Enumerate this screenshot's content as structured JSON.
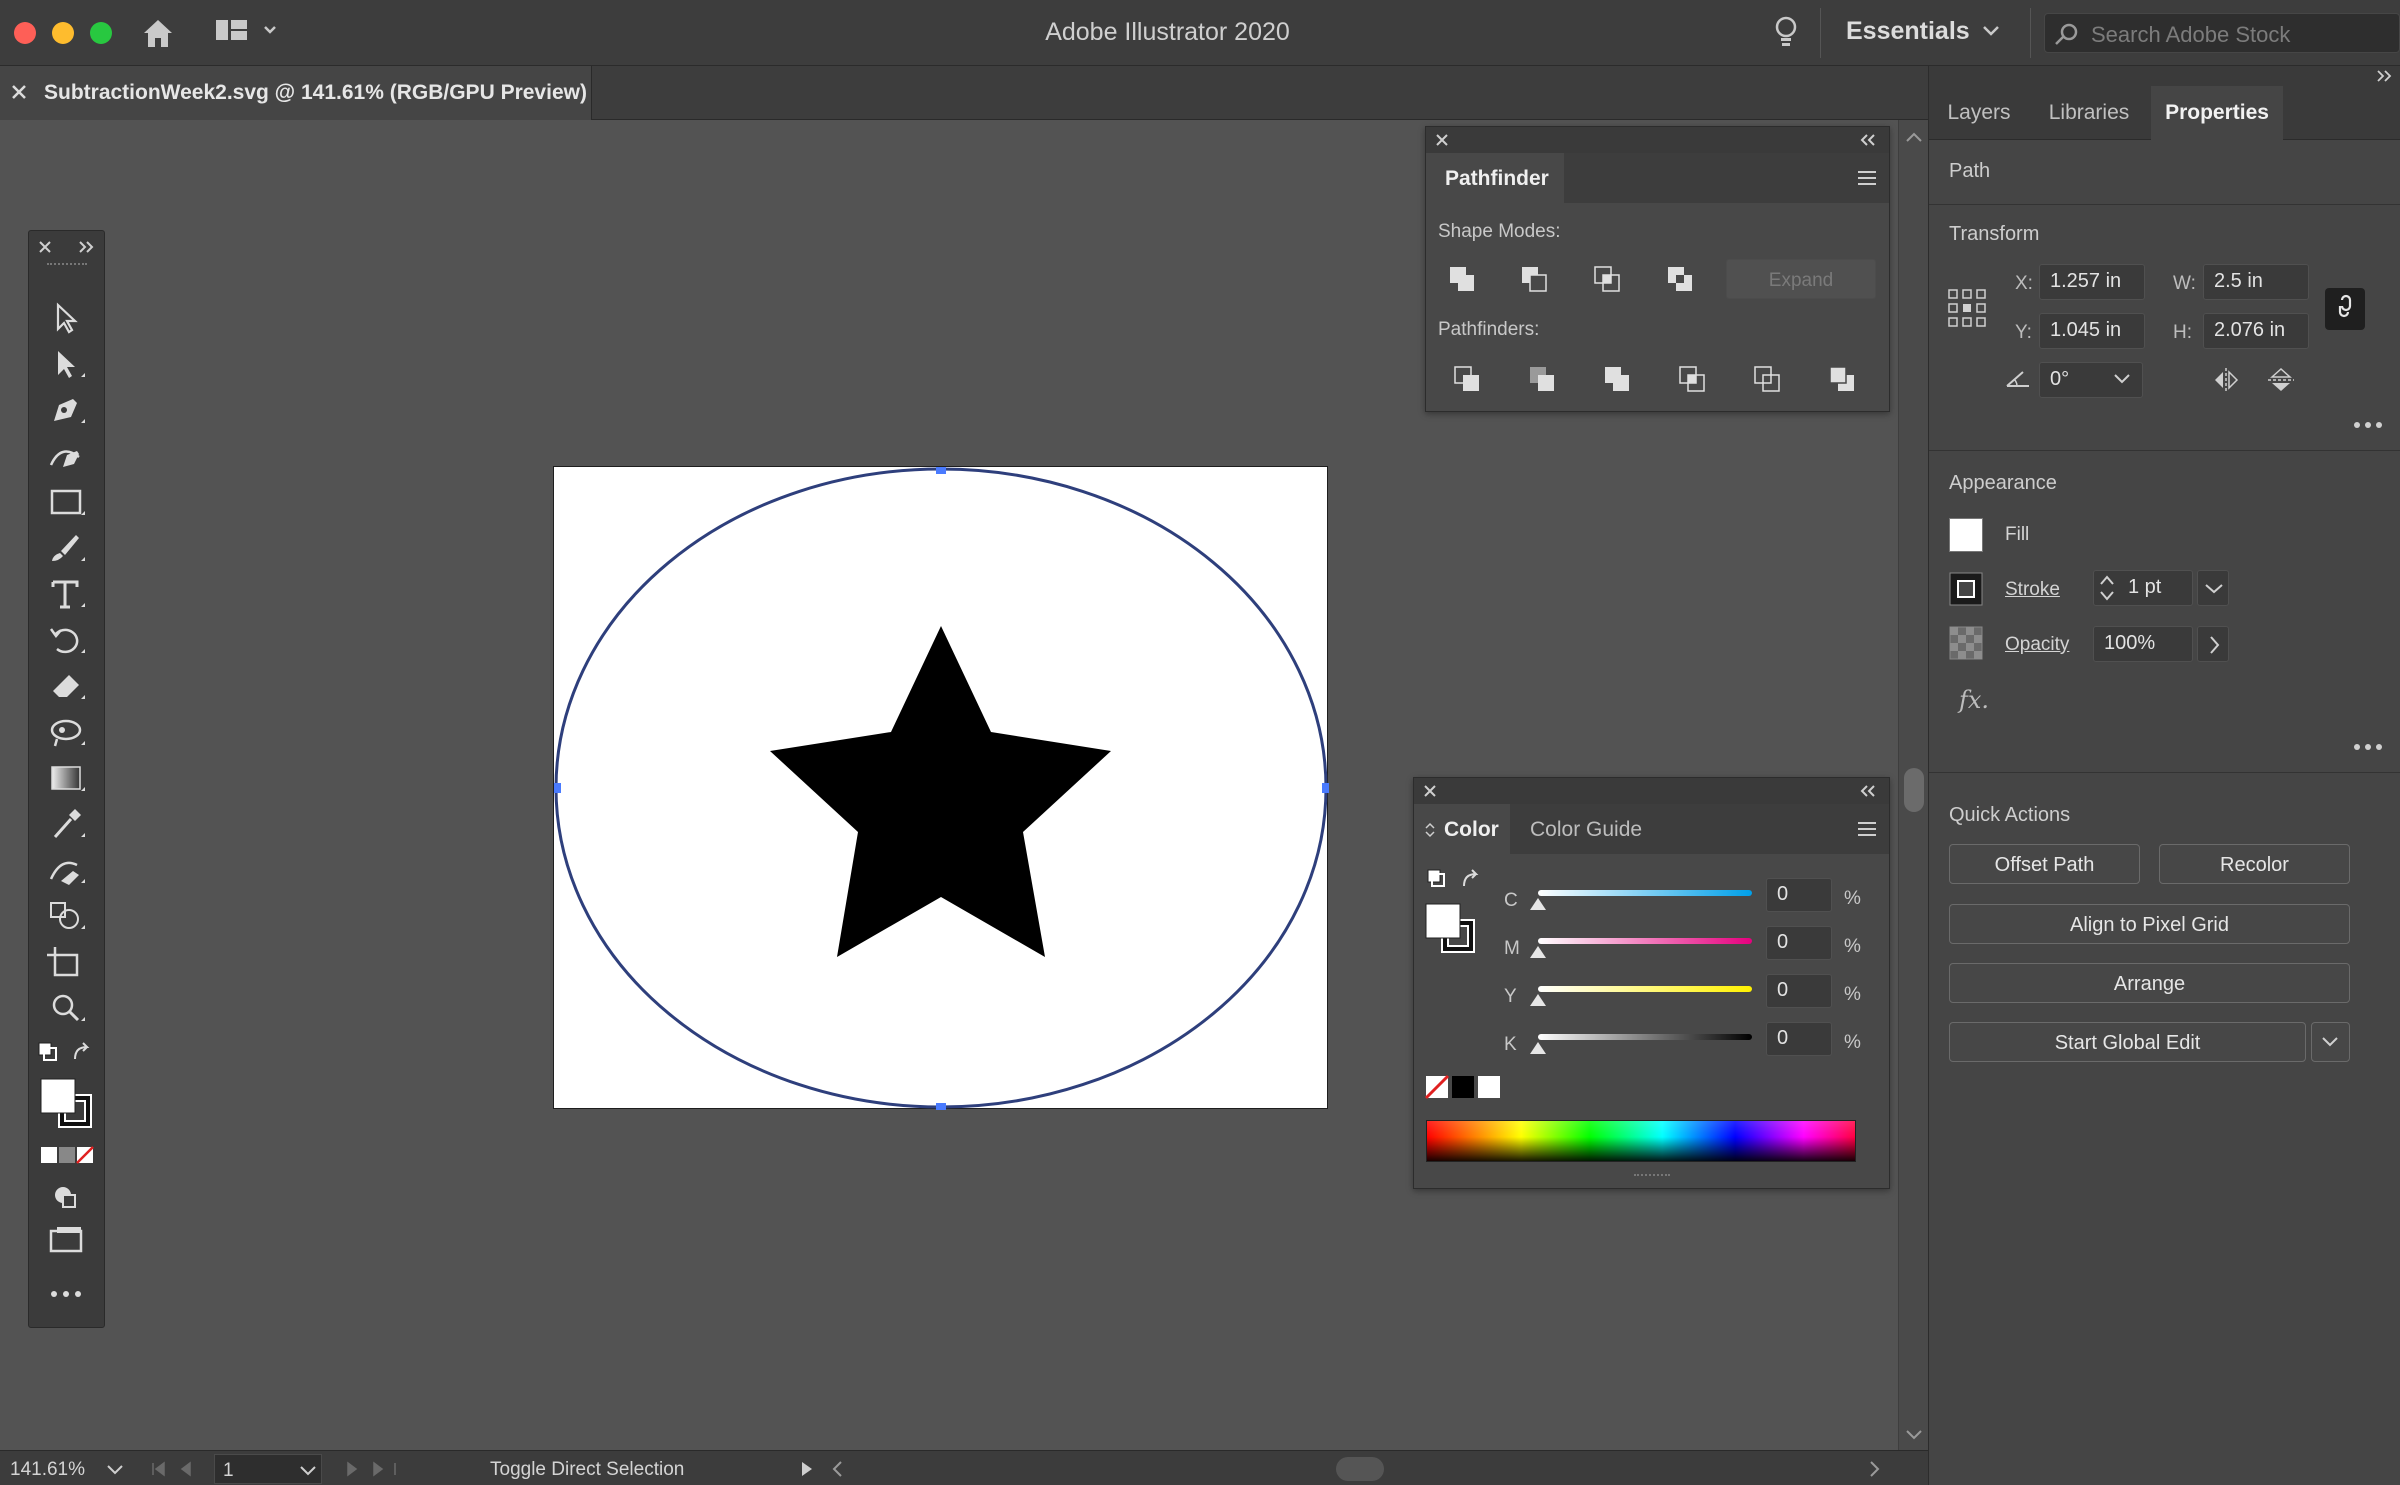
{
  "window": {
    "title": "Adobe Illustrator 2020"
  },
  "header": {
    "workspace": "Essentials",
    "stock_search_placeholder": "Search Adobe Stock"
  },
  "document": {
    "tab_title": "SubtractionWeek2.svg @ 141.61% (RGB/GPU Preview)"
  },
  "pathfinder": {
    "tab": "Pathfinder",
    "shape_modes_label": "Shape Modes:",
    "expand_label": "Expand",
    "pathfinders_label": "Pathfinders:"
  },
  "color_panel": {
    "tabs": [
      "Color",
      "Color Guide"
    ],
    "channels": [
      {
        "label": "C",
        "value": "0",
        "unit": "%",
        "gradient": "linear-gradient(90deg,#ffffff,#00a0e9)"
      },
      {
        "label": "M",
        "value": "0",
        "unit": "%",
        "gradient": "linear-gradient(90deg,#ffffff,#e5007e)"
      },
      {
        "label": "Y",
        "value": "0",
        "unit": "%",
        "gradient": "linear-gradient(90deg,#ffffff,#fff100)"
      },
      {
        "label": "K",
        "value": "0",
        "unit": "%",
        "gradient": "linear-gradient(90deg,#ffffff,#000000)"
      }
    ]
  },
  "properties": {
    "tabs": [
      "Layers",
      "Libraries",
      "Properties"
    ],
    "selection_type": "Path",
    "transform": {
      "title": "Transform",
      "x_label": "X:",
      "x": "1.257 in",
      "y_label": "Y:",
      "y": "1.045 in",
      "w_label": "W:",
      "w": "2.5 in",
      "h_label": "H:",
      "h": "2.076 in",
      "angle": "0°"
    },
    "appearance": {
      "title": "Appearance",
      "fill_label": "Fill",
      "stroke_label": "Stroke",
      "stroke_weight": "1 pt",
      "opacity_label": "Opacity",
      "opacity": "100%",
      "fx_label": "fx."
    },
    "quick_actions": {
      "title": "Quick Actions",
      "offset_path": "Offset Path",
      "recolor": "Recolor",
      "align_pixel_grid": "Align to Pixel Grid",
      "arrange": "Arrange",
      "start_global_edit": "Start Global Edit"
    }
  },
  "status": {
    "zoom": "141.61%",
    "artboard_number": "1",
    "tool_hint": "Toggle Direct Selection"
  },
  "colors": {
    "accent_blue": "#3d6fe0",
    "path_stroke": "#2e3f7c",
    "panel_bg": "#484848"
  }
}
